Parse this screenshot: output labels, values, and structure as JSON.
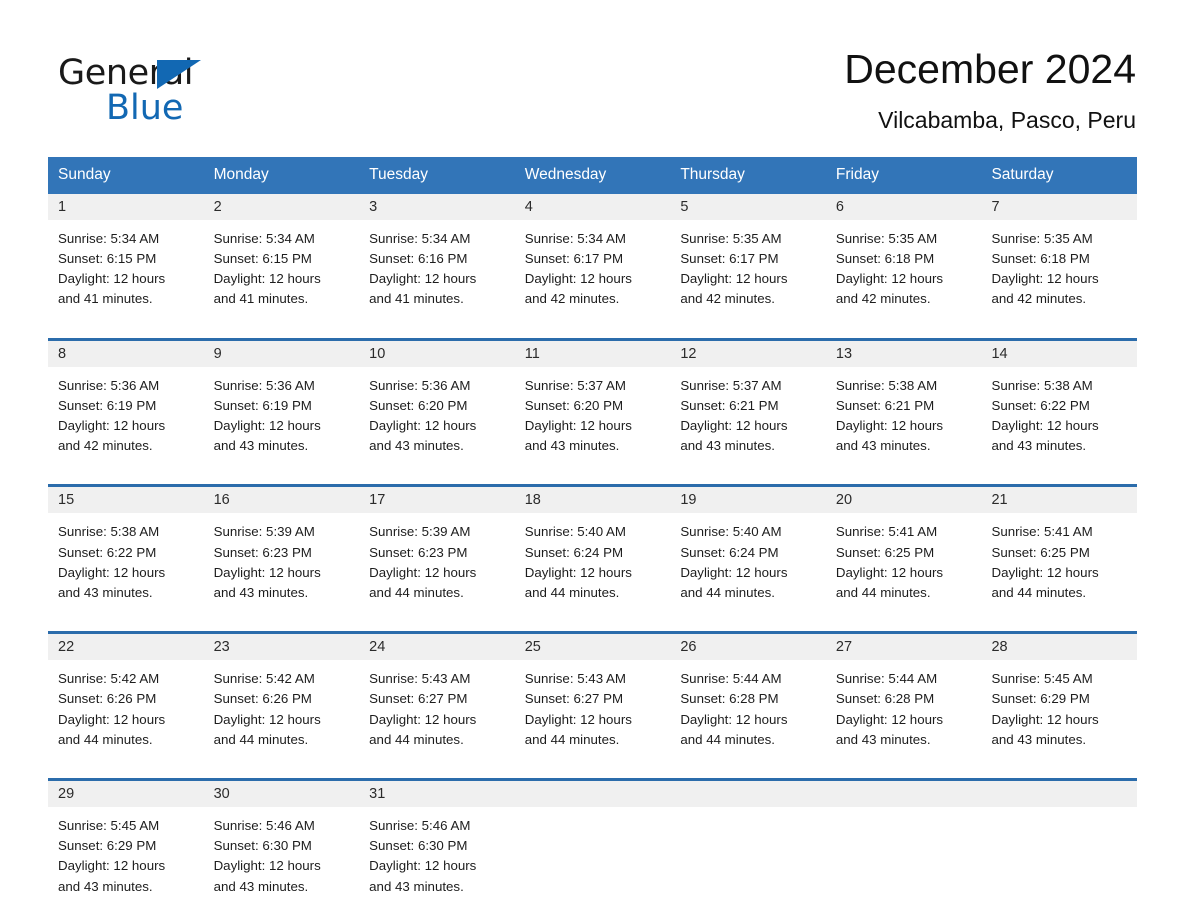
{
  "brand": {
    "name_part1": "General",
    "name_part2": "Blue",
    "triangle_color": "#1268b3",
    "text_color": "#1a1a1a"
  },
  "header": {
    "month_title": "December 2024",
    "location": "Vilcabamba, Pasco, Peru"
  },
  "theme": {
    "header_blue": "#3275b8",
    "row_border_blue": "#2b6cab",
    "day_band_gray": "#f0f0f0",
    "page_background": "#ffffff"
  },
  "calendar": {
    "weekdays": [
      "Sunday",
      "Monday",
      "Tuesday",
      "Wednesday",
      "Thursday",
      "Friday",
      "Saturday"
    ],
    "weeks": [
      [
        {
          "day": "1",
          "sunrise": "Sunrise: 5:34 AM",
          "sunset": "Sunset: 6:15 PM",
          "daylight_line1": "Daylight: 12 hours",
          "daylight_line2": "and 41 minutes."
        },
        {
          "day": "2",
          "sunrise": "Sunrise: 5:34 AM",
          "sunset": "Sunset: 6:15 PM",
          "daylight_line1": "Daylight: 12 hours",
          "daylight_line2": "and 41 minutes."
        },
        {
          "day": "3",
          "sunrise": "Sunrise: 5:34 AM",
          "sunset": "Sunset: 6:16 PM",
          "daylight_line1": "Daylight: 12 hours",
          "daylight_line2": "and 41 minutes."
        },
        {
          "day": "4",
          "sunrise": "Sunrise: 5:34 AM",
          "sunset": "Sunset: 6:17 PM",
          "daylight_line1": "Daylight: 12 hours",
          "daylight_line2": "and 42 minutes."
        },
        {
          "day": "5",
          "sunrise": "Sunrise: 5:35 AM",
          "sunset": "Sunset: 6:17 PM",
          "daylight_line1": "Daylight: 12 hours",
          "daylight_line2": "and 42 minutes."
        },
        {
          "day": "6",
          "sunrise": "Sunrise: 5:35 AM",
          "sunset": "Sunset: 6:18 PM",
          "daylight_line1": "Daylight: 12 hours",
          "daylight_line2": "and 42 minutes."
        },
        {
          "day": "7",
          "sunrise": "Sunrise: 5:35 AM",
          "sunset": "Sunset: 6:18 PM",
          "daylight_line1": "Daylight: 12 hours",
          "daylight_line2": "and 42 minutes."
        }
      ],
      [
        {
          "day": "8",
          "sunrise": "Sunrise: 5:36 AM",
          "sunset": "Sunset: 6:19 PM",
          "daylight_line1": "Daylight: 12 hours",
          "daylight_line2": "and 42 minutes."
        },
        {
          "day": "9",
          "sunrise": "Sunrise: 5:36 AM",
          "sunset": "Sunset: 6:19 PM",
          "daylight_line1": "Daylight: 12 hours",
          "daylight_line2": "and 43 minutes."
        },
        {
          "day": "10",
          "sunrise": "Sunrise: 5:36 AM",
          "sunset": "Sunset: 6:20 PM",
          "daylight_line1": "Daylight: 12 hours",
          "daylight_line2": "and 43 minutes."
        },
        {
          "day": "11",
          "sunrise": "Sunrise: 5:37 AM",
          "sunset": "Sunset: 6:20 PM",
          "daylight_line1": "Daylight: 12 hours",
          "daylight_line2": "and 43 minutes."
        },
        {
          "day": "12",
          "sunrise": "Sunrise: 5:37 AM",
          "sunset": "Sunset: 6:21 PM",
          "daylight_line1": "Daylight: 12 hours",
          "daylight_line2": "and 43 minutes."
        },
        {
          "day": "13",
          "sunrise": "Sunrise: 5:38 AM",
          "sunset": "Sunset: 6:21 PM",
          "daylight_line1": "Daylight: 12 hours",
          "daylight_line2": "and 43 minutes."
        },
        {
          "day": "14",
          "sunrise": "Sunrise: 5:38 AM",
          "sunset": "Sunset: 6:22 PM",
          "daylight_line1": "Daylight: 12 hours",
          "daylight_line2": "and 43 minutes."
        }
      ],
      [
        {
          "day": "15",
          "sunrise": "Sunrise: 5:38 AM",
          "sunset": "Sunset: 6:22 PM",
          "daylight_line1": "Daylight: 12 hours",
          "daylight_line2": "and 43 minutes."
        },
        {
          "day": "16",
          "sunrise": "Sunrise: 5:39 AM",
          "sunset": "Sunset: 6:23 PM",
          "daylight_line1": "Daylight: 12 hours",
          "daylight_line2": "and 43 minutes."
        },
        {
          "day": "17",
          "sunrise": "Sunrise: 5:39 AM",
          "sunset": "Sunset: 6:23 PM",
          "daylight_line1": "Daylight: 12 hours",
          "daylight_line2": "and 44 minutes."
        },
        {
          "day": "18",
          "sunrise": "Sunrise: 5:40 AM",
          "sunset": "Sunset: 6:24 PM",
          "daylight_line1": "Daylight: 12 hours",
          "daylight_line2": "and 44 minutes."
        },
        {
          "day": "19",
          "sunrise": "Sunrise: 5:40 AM",
          "sunset": "Sunset: 6:24 PM",
          "daylight_line1": "Daylight: 12 hours",
          "daylight_line2": "and 44 minutes."
        },
        {
          "day": "20",
          "sunrise": "Sunrise: 5:41 AM",
          "sunset": "Sunset: 6:25 PM",
          "daylight_line1": "Daylight: 12 hours",
          "daylight_line2": "and 44 minutes."
        },
        {
          "day": "21",
          "sunrise": "Sunrise: 5:41 AM",
          "sunset": "Sunset: 6:25 PM",
          "daylight_line1": "Daylight: 12 hours",
          "daylight_line2": "and 44 minutes."
        }
      ],
      [
        {
          "day": "22",
          "sunrise": "Sunrise: 5:42 AM",
          "sunset": "Sunset: 6:26 PM",
          "daylight_line1": "Daylight: 12 hours",
          "daylight_line2": "and 44 minutes."
        },
        {
          "day": "23",
          "sunrise": "Sunrise: 5:42 AM",
          "sunset": "Sunset: 6:26 PM",
          "daylight_line1": "Daylight: 12 hours",
          "daylight_line2": "and 44 minutes."
        },
        {
          "day": "24",
          "sunrise": "Sunrise: 5:43 AM",
          "sunset": "Sunset: 6:27 PM",
          "daylight_line1": "Daylight: 12 hours",
          "daylight_line2": "and 44 minutes."
        },
        {
          "day": "25",
          "sunrise": "Sunrise: 5:43 AM",
          "sunset": "Sunset: 6:27 PM",
          "daylight_line1": "Daylight: 12 hours",
          "daylight_line2": "and 44 minutes."
        },
        {
          "day": "26",
          "sunrise": "Sunrise: 5:44 AM",
          "sunset": "Sunset: 6:28 PM",
          "daylight_line1": "Daylight: 12 hours",
          "daylight_line2": "and 44 minutes."
        },
        {
          "day": "27",
          "sunrise": "Sunrise: 5:44 AM",
          "sunset": "Sunset: 6:28 PM",
          "daylight_line1": "Daylight: 12 hours",
          "daylight_line2": "and 43 minutes."
        },
        {
          "day": "28",
          "sunrise": "Sunrise: 5:45 AM",
          "sunset": "Sunset: 6:29 PM",
          "daylight_line1": "Daylight: 12 hours",
          "daylight_line2": "and 43 minutes."
        }
      ],
      [
        {
          "day": "29",
          "sunrise": "Sunrise: 5:45 AM",
          "sunset": "Sunset: 6:29 PM",
          "daylight_line1": "Daylight: 12 hours",
          "daylight_line2": "and 43 minutes."
        },
        {
          "day": "30",
          "sunrise": "Sunrise: 5:46 AM",
          "sunset": "Sunset: 6:30 PM",
          "daylight_line1": "Daylight: 12 hours",
          "daylight_line2": "and 43 minutes."
        },
        {
          "day": "31",
          "sunrise": "Sunrise: 5:46 AM",
          "sunset": "Sunset: 6:30 PM",
          "daylight_line1": "Daylight: 12 hours",
          "daylight_line2": "and 43 minutes."
        },
        {
          "day": "",
          "sunrise": "",
          "sunset": "",
          "daylight_line1": "",
          "daylight_line2": ""
        },
        {
          "day": "",
          "sunrise": "",
          "sunset": "",
          "daylight_line1": "",
          "daylight_line2": ""
        },
        {
          "day": "",
          "sunrise": "",
          "sunset": "",
          "daylight_line1": "",
          "daylight_line2": ""
        },
        {
          "day": "",
          "sunrise": "",
          "sunset": "",
          "daylight_line1": "",
          "daylight_line2": ""
        }
      ]
    ]
  }
}
